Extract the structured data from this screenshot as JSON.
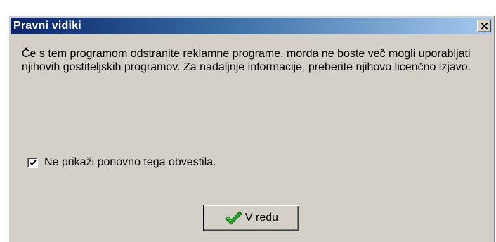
{
  "dialog": {
    "title": "Pravni vidiki",
    "message": "Če s tem programom odstranite reklamne programe, morda ne boste več mogli uporabljati njihovih gostiteljskih programov. Za nadaljnje informacije, preberite njihovo licenčno izjavo.",
    "checkbox": {
      "label": "Ne prikaži ponovno tega obvestila.",
      "checked": true
    },
    "ok_button": {
      "label": "V redu",
      "icon": "green-checkmark-icon"
    },
    "close_icon": "close-icon"
  },
  "colors": {
    "title_gradient_start": "#0a246a",
    "title_gradient_end": "#a6caf0",
    "window_face": "#d4d0c8",
    "checkmark_green": "#2aa02a"
  }
}
